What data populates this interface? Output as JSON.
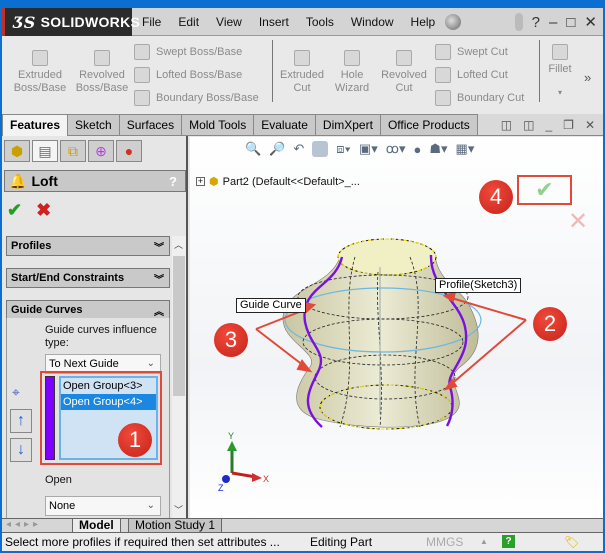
{
  "app": {
    "brand": "SOLIDWORKS",
    "menu": [
      "File",
      "Edit",
      "View",
      "Insert",
      "Tools",
      "Window",
      "Help"
    ],
    "window_controls": {
      "help": "?",
      "minimize": "–",
      "restore": "□",
      "close": "✕"
    }
  },
  "command_manager": {
    "buttons": [
      {
        "label": "Extruded\nBoss/Base"
      },
      {
        "label": "Revolved\nBoss/Base"
      },
      {
        "label": "Swept Boss/Base"
      },
      {
        "label": "Lofted Boss/Base"
      },
      {
        "label": "Boundary Boss/Base"
      },
      {
        "label": "Extruded\nCut"
      },
      {
        "label": "Hole\nWizard"
      },
      {
        "label": "Revolved\nCut"
      },
      {
        "label": "Swept Cut"
      },
      {
        "label": "Lofted Cut"
      },
      {
        "label": "Boundary Cut"
      },
      {
        "label": "Fillet"
      }
    ],
    "more": "»"
  },
  "tabs": [
    "Features",
    "Sketch",
    "Surfaces",
    "Mold Tools",
    "Evaluate",
    "DimXpert",
    "Office Products"
  ],
  "active_tab": "Features",
  "property_manager": {
    "title": "Loft",
    "help": "?",
    "ok": "✔",
    "cancel": "✖",
    "sections": [
      {
        "label": "Profiles",
        "state": "collapsed",
        "chevron": "⌄⌄"
      },
      {
        "label": "Start/End Constraints",
        "state": "collapsed",
        "chevron": "⌄⌄"
      },
      {
        "label": "Guide Curves",
        "state": "expanded",
        "chevron": "⌃⌃"
      }
    ],
    "guide_influence_label": "Guide curves influence type:",
    "guide_influence_value": "To Next Guide",
    "guide_list": [
      "Open Group<3>",
      "Open Group<4>"
    ],
    "guide_list_selected": "Open Group<4>",
    "guide_color": "#8000ff",
    "open_label": "Open",
    "open_value": "None"
  },
  "viewport": {
    "tree_item": "Part2  (Default<<Default>_...",
    "callouts": {
      "guide_curve": "Guide Curve",
      "profile": "Profile(Sketch3)"
    },
    "badges": [
      "1",
      "2",
      "3",
      "4"
    ],
    "axes": {
      "x": "X",
      "y": "Y",
      "z": "Z"
    }
  },
  "bottom_tabs": [
    "Model",
    "Motion Study 1"
  ],
  "status_bar": {
    "message": "Select more profiles if required then set attributes ...",
    "mode": "Editing Part",
    "units": "MMGS"
  },
  "colors": {
    "accent_red": "#e04a3a",
    "selection_blue": "#1c87e0",
    "guide_purple": "#8000ff"
  }
}
